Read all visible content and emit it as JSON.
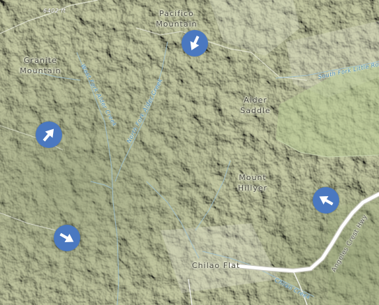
{
  "map": {
    "elevation_label": "6402 ft",
    "places": {
      "pacifico": "Pacifico\nMountain",
      "granite": "Granite\nMountain",
      "alder_saddle": "Alder\nSaddle",
      "mount_hillyer": "Mount\nHillyer",
      "chilao_flat": "Chilao Flat"
    },
    "water": {
      "west_fork": "West Fork Alder Creek",
      "north_fork": "North Fork Alder Creek",
      "south_fork": "South Fork Little Rock",
      "chilao_creek": "Chilao Creek"
    },
    "roads": {
      "angeles_crest": "Angeles Crest Hwy"
    },
    "markers": [
      {
        "name": "wind-arrow-marker-pacifico",
        "direction_deg": 205,
        "icon": "arrow-icon"
      },
      {
        "name": "wind-arrow-marker-granite",
        "direction_deg": 40,
        "icon": "arrow-icon"
      },
      {
        "name": "wind-arrow-marker-southwest",
        "direction_deg": 120,
        "icon": "arrow-icon"
      },
      {
        "name": "wind-arrow-marker-angeles-crest",
        "direction_deg": 300,
        "icon": "arrow-icon"
      }
    ],
    "colors": {
      "marker": "#4a78c0",
      "water": "#4f8fb8",
      "road": "#ffffff",
      "terrain": "#cfd3b3"
    }
  }
}
